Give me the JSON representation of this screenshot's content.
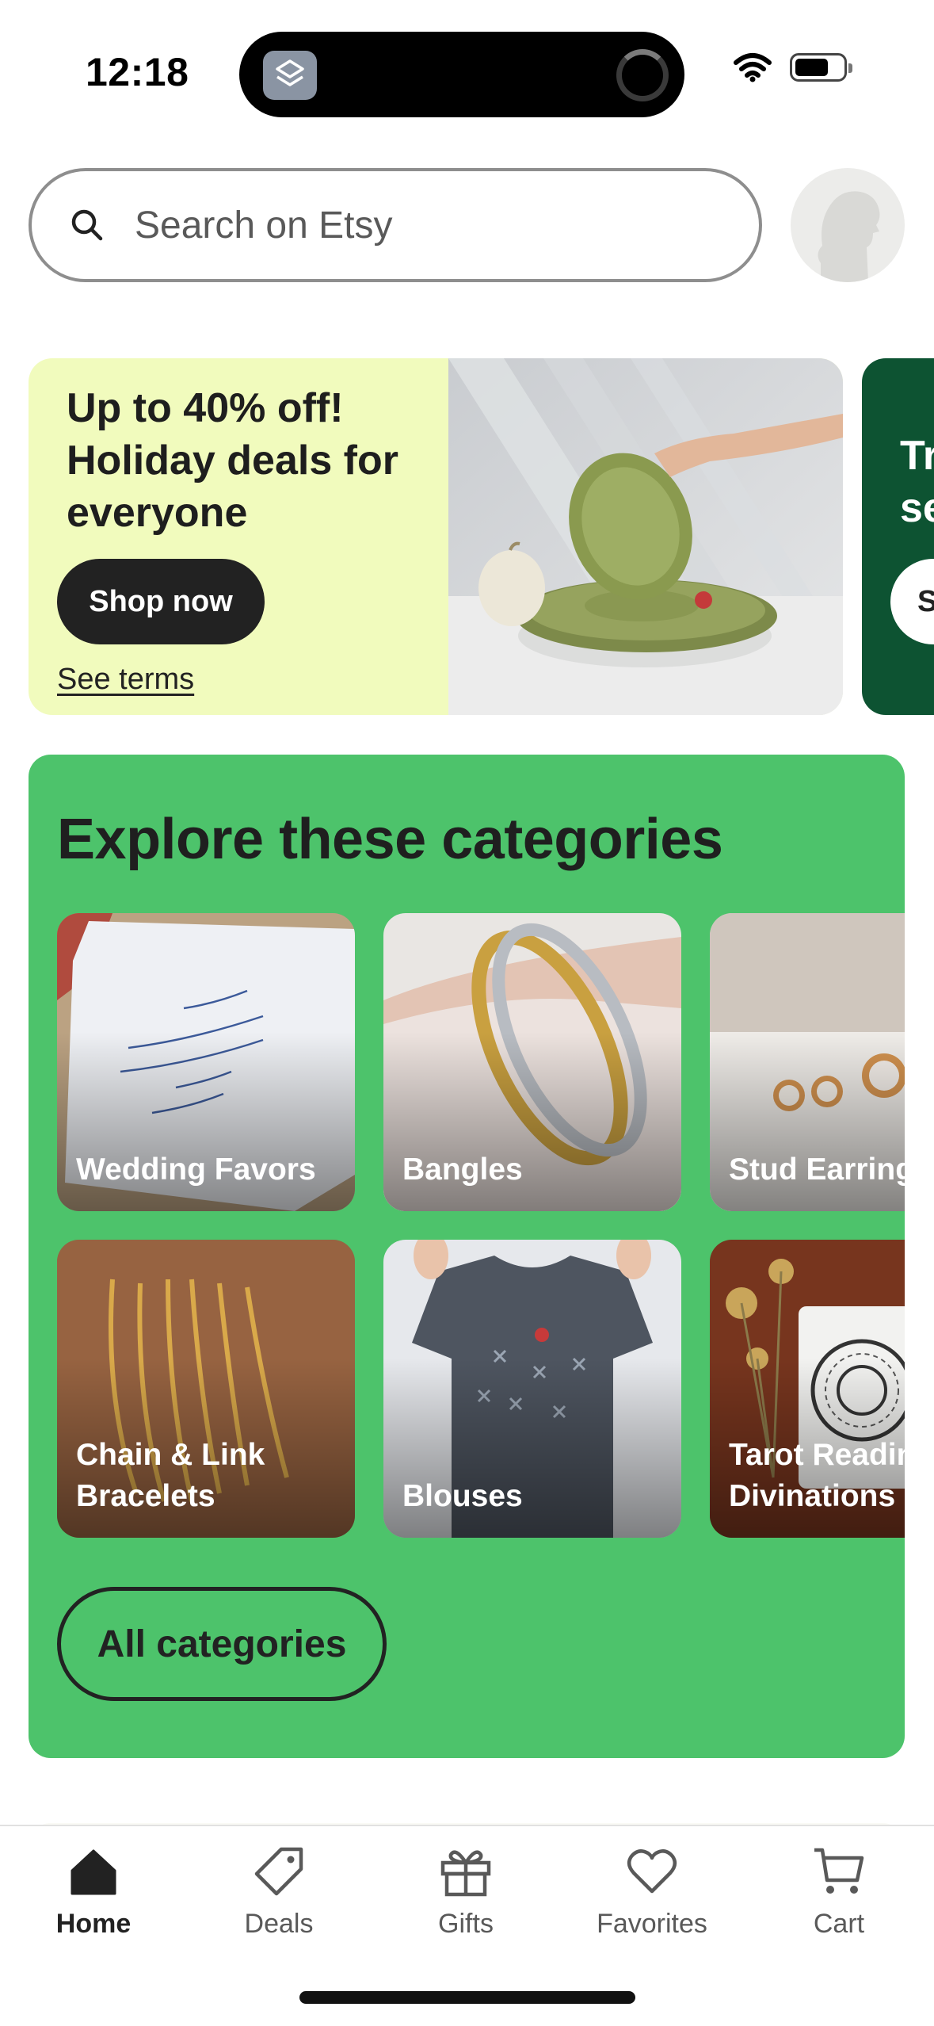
{
  "status_bar": {
    "time": "12:18",
    "icons": [
      "app-switcher-icon",
      "loading-spinner-icon",
      "wifi-icon",
      "battery-icon"
    ],
    "battery_level": 0.7
  },
  "search": {
    "placeholder": "Search on Etsy"
  },
  "banners": [
    {
      "title": "Up to 40% off! Holiday deals for everyone",
      "button": "Shop now",
      "link": "See terms",
      "background": "#f1fbbd"
    },
    {
      "title_partial": "Tr\nse",
      "button_partial": "S",
      "background": "#0d5332"
    }
  ],
  "categories": {
    "title": "Explore these categories",
    "tiles": [
      {
        "label": "Wedding Favors"
      },
      {
        "label": "Bangles"
      },
      {
        "label": "Stud Earrings"
      },
      {
        "label": "Chain & Link\nBracelets"
      },
      {
        "label": "Blouses"
      },
      {
        "label": "Tarot Reading\nDivinations"
      }
    ],
    "all_button": "All categories",
    "background": "#4dc36b"
  },
  "tab_bar": {
    "tabs": [
      {
        "label": "Home",
        "icon": "home-icon",
        "active": true
      },
      {
        "label": "Deals",
        "icon": "tag-icon",
        "active": false
      },
      {
        "label": "Gifts",
        "icon": "gift-icon",
        "active": false
      },
      {
        "label": "Favorites",
        "icon": "heart-icon",
        "active": false
      },
      {
        "label": "Cart",
        "icon": "cart-icon",
        "active": false
      }
    ]
  }
}
